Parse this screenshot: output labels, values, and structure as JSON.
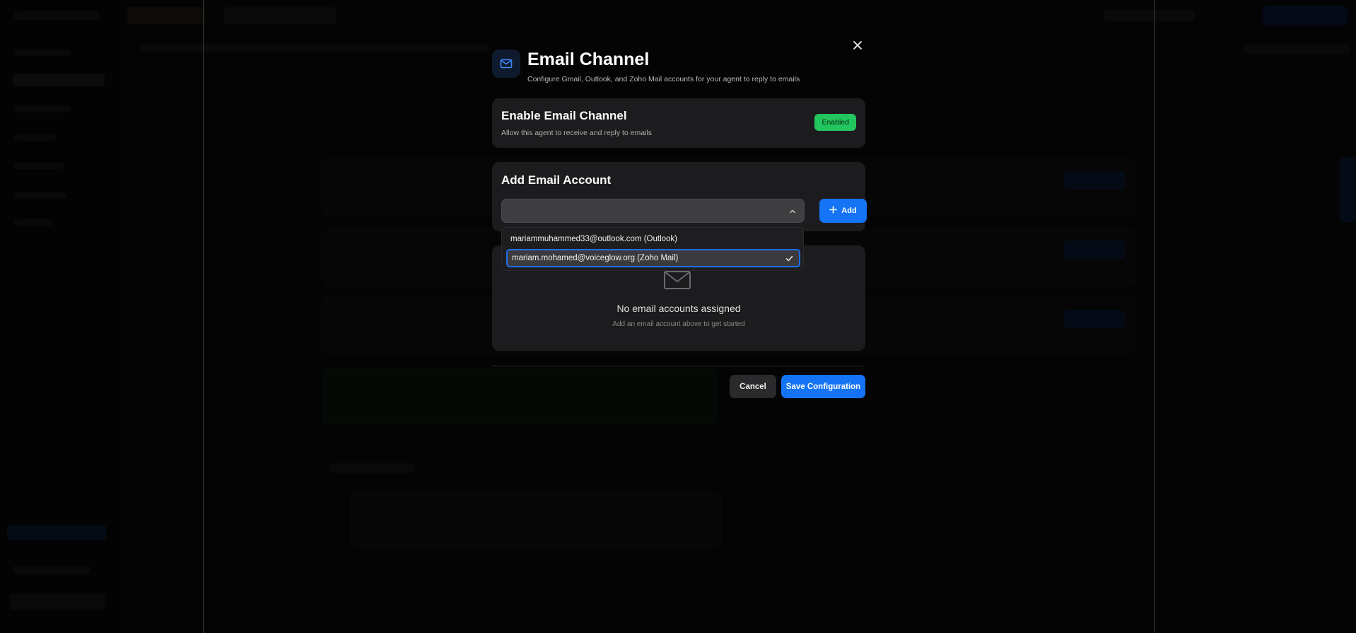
{
  "modal": {
    "title": "Email Channel",
    "subtitle": "Configure Gmail, Outlook, and Zoho Mail accounts for your agent to reply to emails",
    "close_icon": "close-icon",
    "header_icon": "mail-icon"
  },
  "enable_panel": {
    "title": "Enable Email Channel",
    "description": "Allow this agent to receive and reply to emails",
    "status_badge": "Enabled"
  },
  "add_panel": {
    "title": "Add Email Account",
    "select_value": "",
    "add_label": "Add",
    "dropdown_options": [
      "mariammuhammed33@outlook.com (Outlook)",
      "mariam.mohamed@voiceglow.org (Zoho Mail)"
    ],
    "selected_option_index": 1
  },
  "empty_state": {
    "title": "No email accounts assigned",
    "description": "Add an email account above to get started"
  },
  "footer": {
    "cancel_label": "Cancel",
    "save_label": "Save Configuration"
  },
  "colors": {
    "accent": "#1474f5",
    "success": "#22c55e",
    "panel": "#1c1c1e"
  }
}
